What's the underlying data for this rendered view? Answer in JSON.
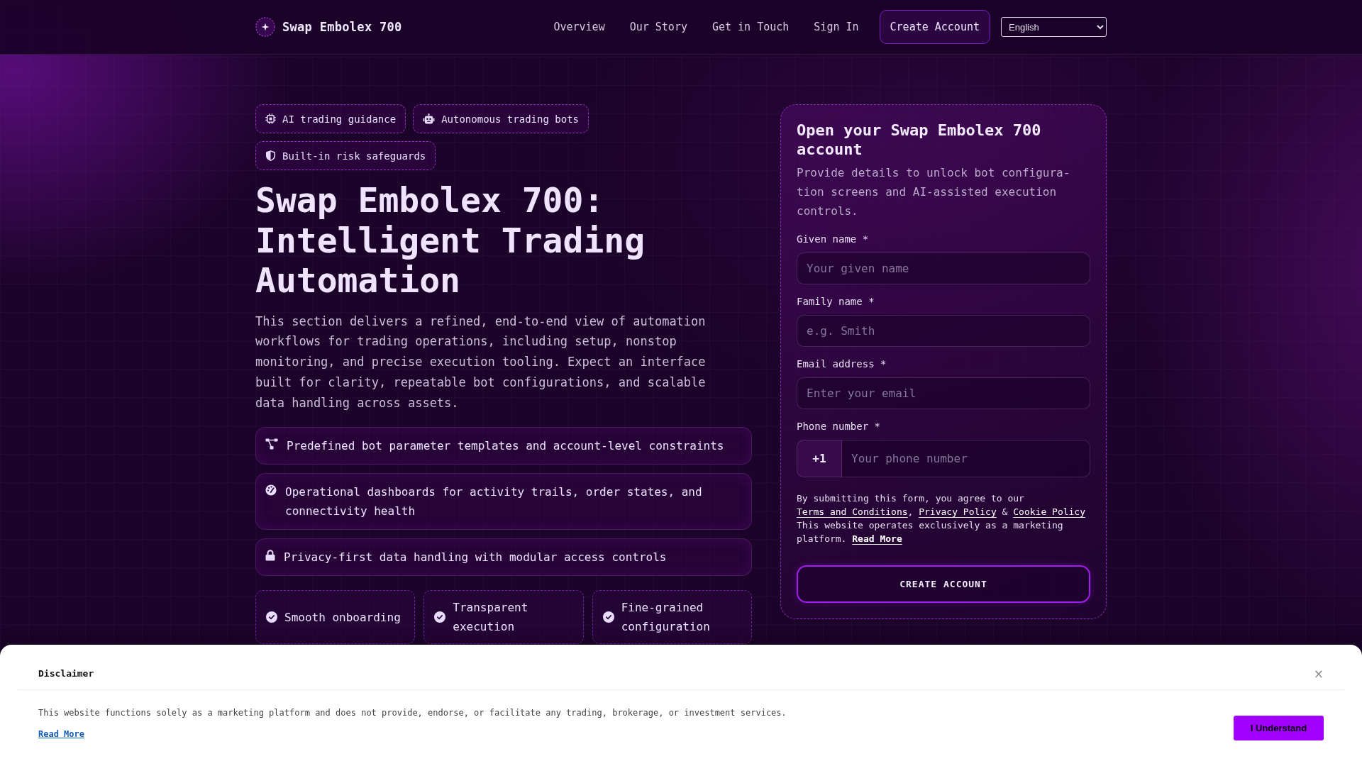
{
  "header": {
    "brand": "Swap Embolex 700",
    "nav": [
      "Overview",
      "Our Story",
      "Get in Touch",
      "Sign In"
    ],
    "cta": "Create Account",
    "language": "English"
  },
  "hero": {
    "chips": [
      "AI trading guidance",
      "Autonomous trading bots",
      "Built-in risk safeguards"
    ],
    "title": "Swap Embolex 700: Intelligent Trading Automation",
    "description": "This section delivers a refined, end-to-end view of automation workflows for trading operations, including setup, nonstop monitoring, and precise execution tooling. Expect an interface built for clarity, repeatable bot configurations, and scalable data handling across assets.",
    "features": [
      "Predefined bot parameter templates and account-level constraints",
      "Operational dashboards for activity trails, order states, and connectivity health",
      "Privacy-first data handling with modular access controls"
    ],
    "highlights": [
      "Smooth onboarding",
      "Transparent execution",
      "Fine-grained configuration"
    ]
  },
  "signup": {
    "title": "Open your Swap Embolex 700 account",
    "subtitle": "Provide details to unlock bot configura-tion screens and AI-assisted execution controls.",
    "fields": [
      {
        "kind": "text",
        "label": "Given name *",
        "placeholder": "Your given name"
      },
      {
        "kind": "text",
        "label": "Family name *",
        "placeholder": "e.g. Smith"
      },
      {
        "kind": "text",
        "label": "Email address *",
        "placeholder": "Enter your email"
      },
      {
        "kind": "phone",
        "label": "Phone number *",
        "prefix": "+1",
        "placeholder": "Your phone number"
      }
    ],
    "consent": [
      {
        "kind": "text",
        "text": "By submitting this form, you agree to our "
      },
      {
        "kind": "link",
        "text": "Terms and Conditions"
      },
      {
        "kind": "text",
        "text": ", "
      },
      {
        "kind": "link",
        "text": "Privacy Policy"
      },
      {
        "kind": "text",
        "text": " & "
      },
      {
        "kind": "link",
        "text": "Cookie Policy"
      }
    ],
    "notice": [
      {
        "kind": "text",
        "text": "This website operates exclusively as a marketing platform. "
      },
      {
        "kind": "strong_link",
        "text": "Read More"
      }
    ],
    "submit": "CREATE ACCOUNT"
  },
  "disclaimer": {
    "title": "Disclaimer",
    "close": "×",
    "text": "This website functions solely as a marketing platform and does not provide, endorse, or facilitate any trading, brokerage, or investment services.",
    "link": "Read More",
    "button": "I Understand"
  }
}
